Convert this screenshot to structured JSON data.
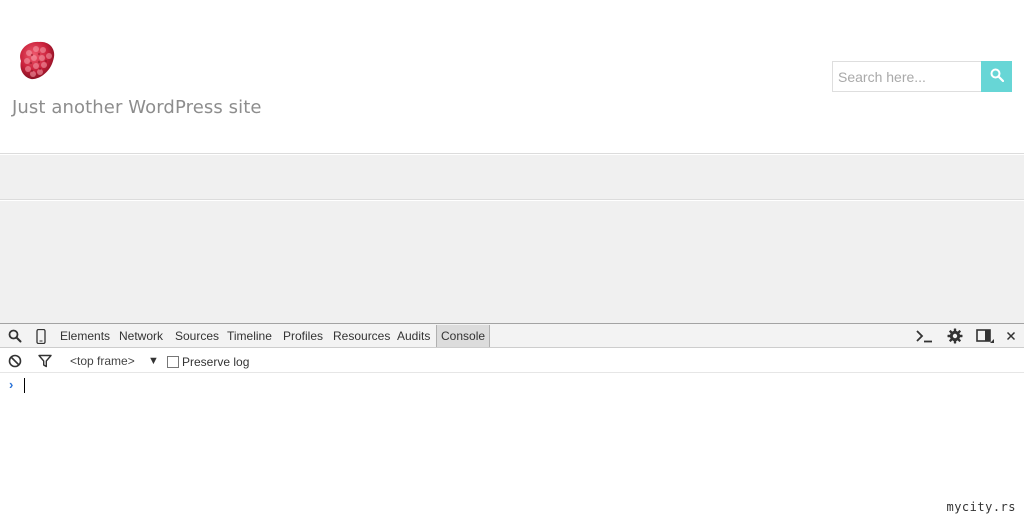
{
  "site": {
    "logo": "raspberry-logo",
    "tagline": "Just another WordPress site",
    "search": {
      "placeholder": "Search here...",
      "button_icon": "search-icon"
    },
    "colors": {
      "accent": "#67d6d6",
      "tagline": "#8d8d8d",
      "nav_bg": "#f0f0f0"
    }
  },
  "devtools": {
    "left_icons": [
      "search-icon",
      "mobile-device-icon"
    ],
    "tabs": [
      {
        "label": "Elements"
      },
      {
        "label": "Network"
      },
      {
        "label": "Sources"
      },
      {
        "label": "Timeline"
      },
      {
        "label": "Profiles"
      },
      {
        "label": "Resources"
      },
      {
        "label": "Audits"
      },
      {
        "label": "Console",
        "active": true
      }
    ],
    "right_icons": [
      "console-drawer-icon",
      "gear-icon",
      "dock-icon",
      "close-icon"
    ],
    "toolbar": {
      "frame": "<top frame>",
      "preserve_log_label": "Preserve log",
      "preserve_log_checked": false
    },
    "console": {
      "prompt": "›"
    }
  },
  "watermark": "mycity.rs"
}
